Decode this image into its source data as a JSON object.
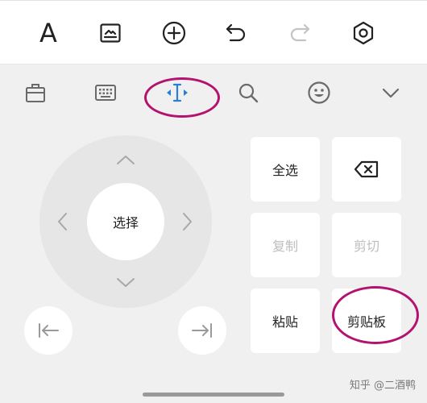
{
  "toolbar": {
    "text_format_label": "A",
    "icons": [
      "letter-a-icon",
      "image-icon",
      "add-circle-icon",
      "undo-icon",
      "redo-icon",
      "settings-hexagon-icon"
    ]
  },
  "keyboard_tabs": [
    "toolbox-icon",
    "keyboard-icon",
    "cursor-move-icon",
    "search-icon",
    "emoji-icon",
    "chevron-down-icon"
  ],
  "dpad": {
    "center_label": "选择"
  },
  "edit_keys": {
    "select_all": "全选",
    "copy": "复制",
    "cut": "剪切",
    "paste": "粘贴",
    "clipboard": "剪贴板"
  },
  "watermark": "知乎 @二酒鸭",
  "colors": {
    "accent": "#2a7fd4",
    "highlight_ring": "#b3126f",
    "disabled_text": "#bdbdbd",
    "background": "#f0f0f0"
  }
}
